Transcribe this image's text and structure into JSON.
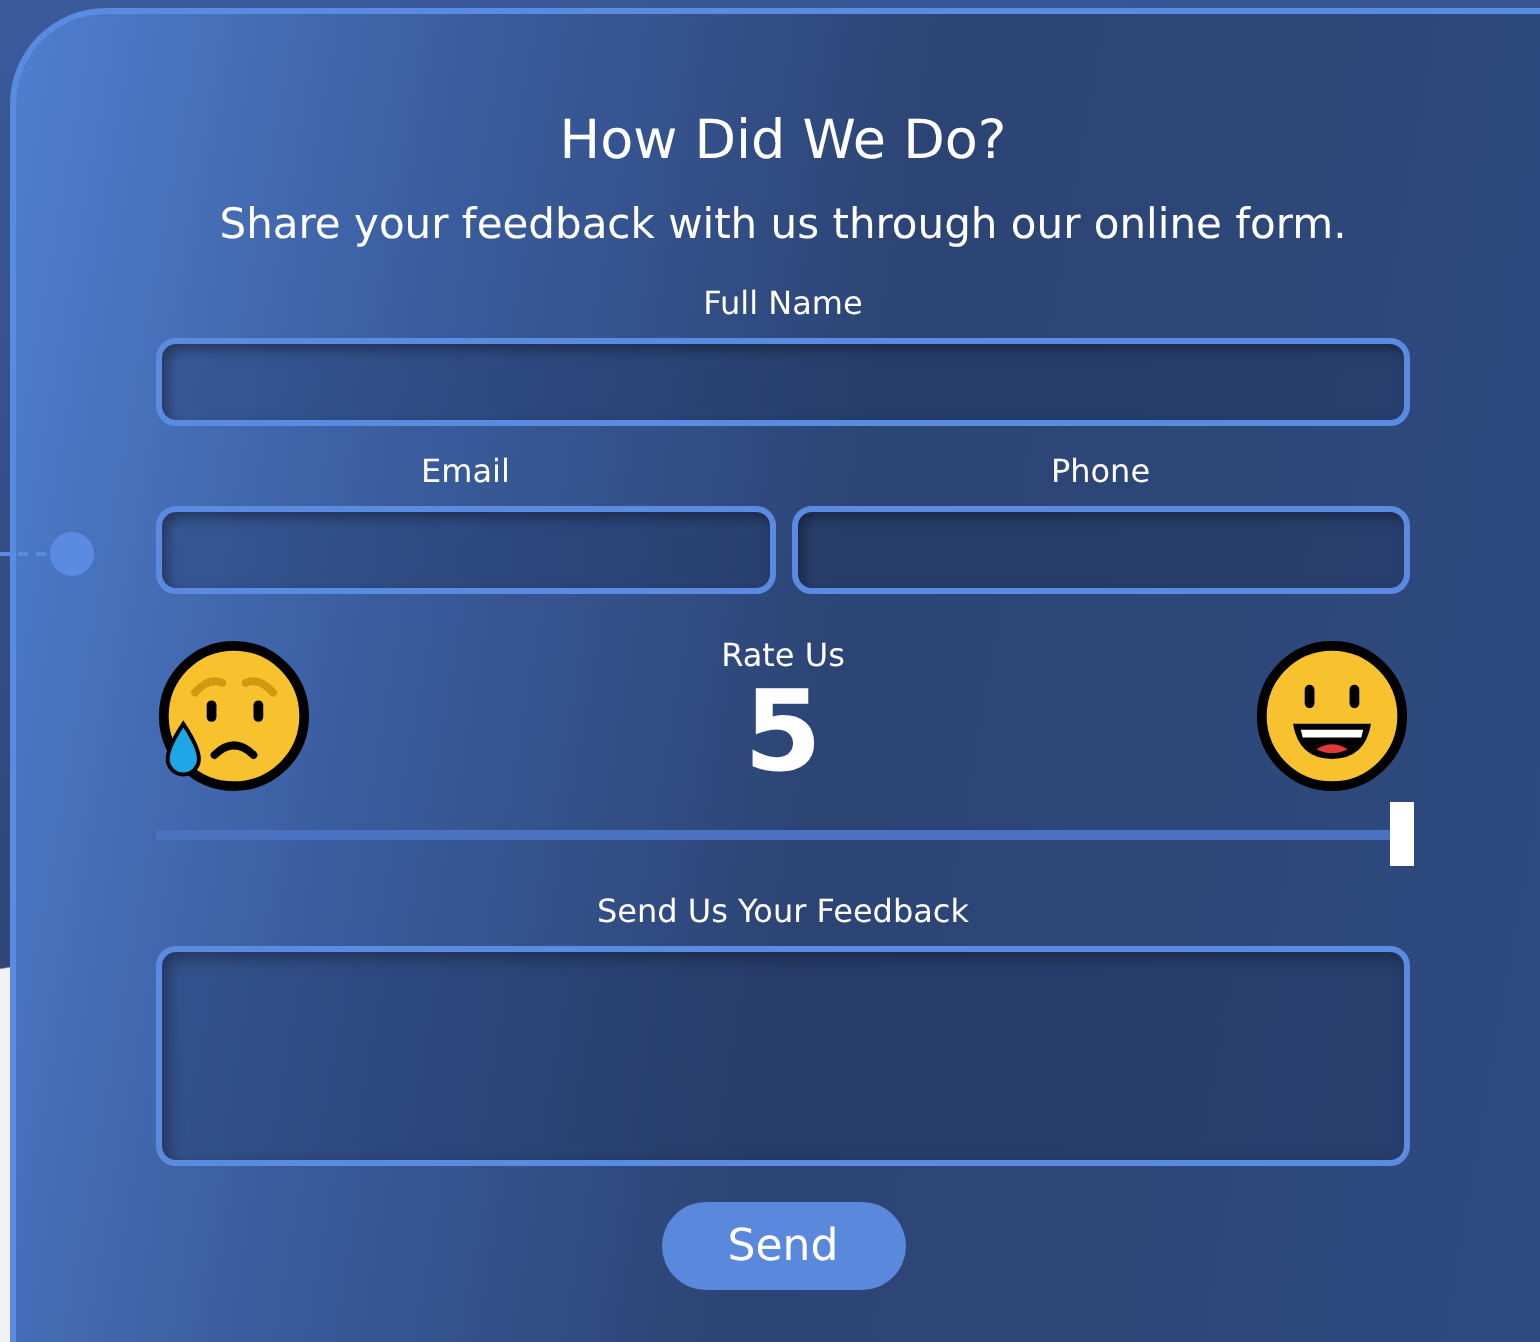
{
  "title": "How Did We Do?",
  "subtitle": "Share your feedback with us through our online form.",
  "fields": [
    {
      "label": "Full Name",
      "kind": "wide"
    },
    {
      "label": "Email",
      "kind": "half"
    },
    {
      "label": "Phone",
      "kind": "half"
    }
  ],
  "rating": {
    "label": "Rate Us",
    "value": "5",
    "level": 1
  },
  "feedback": {
    "label": "Send Us Your Feedback"
  },
  "button": "Send"
}
